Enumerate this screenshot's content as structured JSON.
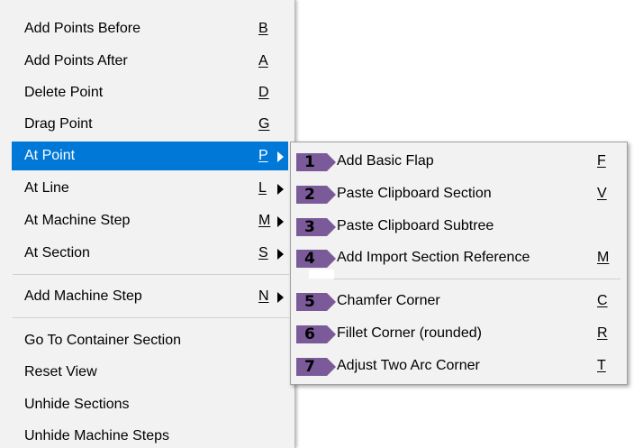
{
  "main_menu": {
    "items": [
      {
        "label": "Add Points Before",
        "shortcut": "B"
      },
      {
        "label": "Add Points After",
        "shortcut": "A"
      },
      {
        "label": "Delete Point",
        "shortcut": "D"
      },
      {
        "label": "Drag Point",
        "shortcut": "G"
      },
      {
        "label": "At Point",
        "shortcut": "P"
      },
      {
        "label": "At Line",
        "shortcut": "L"
      },
      {
        "label": "At Machine Step",
        "shortcut": "M"
      },
      {
        "label": "At Section",
        "shortcut": "S"
      },
      {
        "label": "Add Machine Step",
        "shortcut": "N"
      },
      {
        "label": "Go To Container Section",
        "shortcut": ""
      },
      {
        "label": "Reset View",
        "shortcut": ""
      },
      {
        "label": "Unhide Sections",
        "shortcut": ""
      },
      {
        "label": "Unhide Machine Steps",
        "shortcut": ""
      }
    ],
    "selected_item": "At Point",
    "highlight_color": "#0078d7"
  },
  "sub_menu": {
    "items": [
      {
        "number": "1",
        "label": "Add Basic Flap",
        "shortcut": "F"
      },
      {
        "number": "2",
        "label": "Paste Clipboard Section",
        "shortcut": "V"
      },
      {
        "number": "3",
        "label": "Paste Clipboard Subtree",
        "shortcut": ""
      },
      {
        "number": "4",
        "label": "Add Import Section Reference",
        "shortcut": "M"
      },
      {
        "number": "5",
        "label": "Chamfer Corner",
        "shortcut": "C"
      },
      {
        "number": "6",
        "label": "Fillet Corner (rounded)",
        "shortcut": "R"
      },
      {
        "number": "7",
        "label": "Adjust Two Arc Corner",
        "shortcut": "T"
      }
    ],
    "badge_color": "#7a5a99"
  }
}
